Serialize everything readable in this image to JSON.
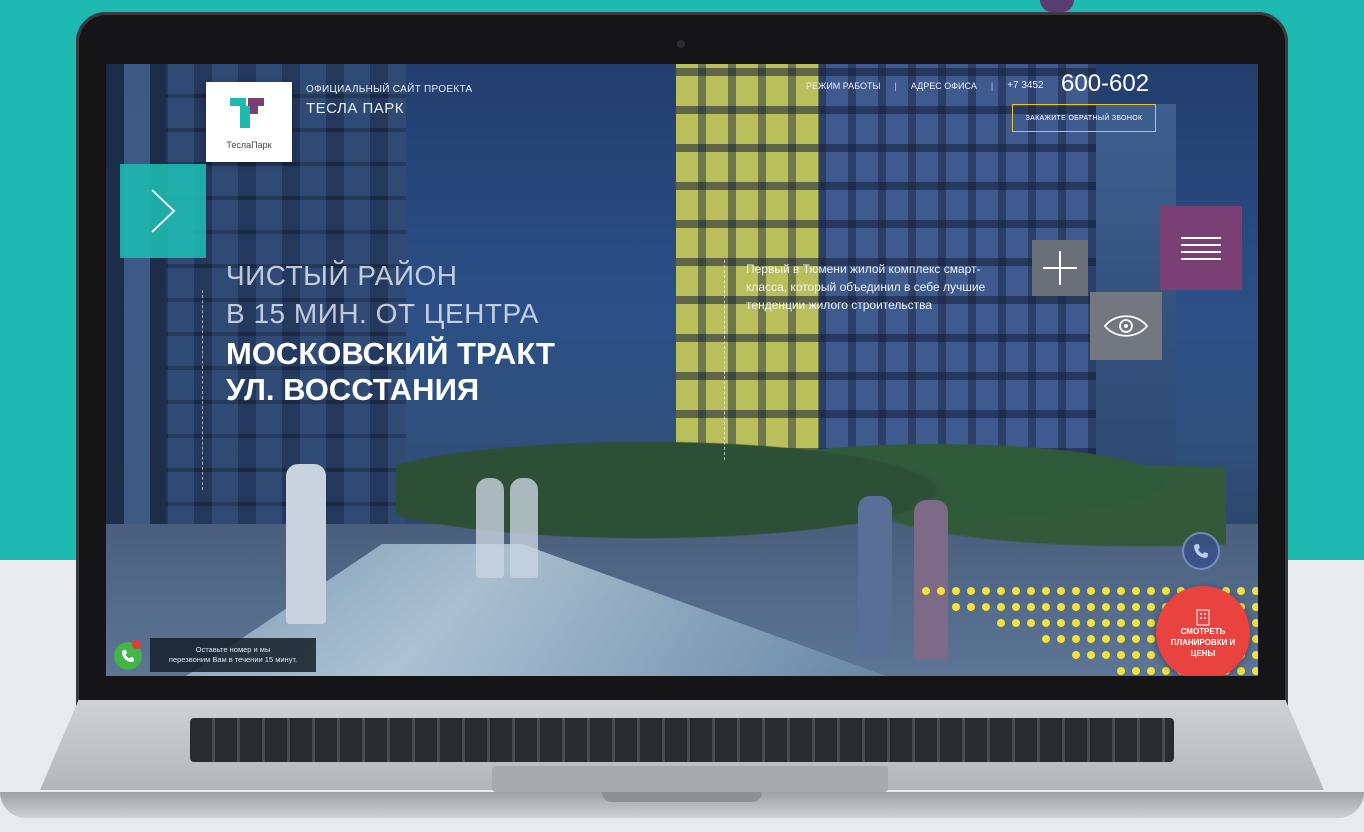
{
  "header": {
    "site_label": "ОФИЦИАЛЬНЫЙ САЙТ ПРОЕКТА",
    "project_name": "ТЕСЛА ПАРК",
    "logo_text": "ТеслаПарк",
    "nav": [
      {
        "label": "РЕЖИМ РАБОТЫ"
      },
      {
        "label": "АДРЕС ОФИСА"
      }
    ],
    "phone_prefix": "+7 3452",
    "phone_main": "600-602",
    "callback_button": "ЗАКАЖИТЕ ОБРАТНЫЙ ЗВОНОК"
  },
  "hero": {
    "line1": "ЧИСТЫЙ РАЙОН",
    "line2": "В 15 МИН. ОТ ЦЕНТРА",
    "line3": "МОСКОВСКИЙ ТРАКТ",
    "line4": "УЛ. ВОССТАНИЯ"
  },
  "description": "Первый в Тюмени жилой комплекс смарт-класса, который объединил в себе лучшие тенденции жилого строительства",
  "callback_widget": {
    "line1": "Оставьте номер и мы",
    "line2": "перезвоним Вам в течении 15 минут."
  },
  "cta": {
    "line1": "СМОТРЕТЬ",
    "line2": "ПЛАНИРОВКИ И",
    "line3": "ЦЕНЫ"
  },
  "icons": {
    "arrow": "chevron-right-icon",
    "menu": "hamburger-menu-icon",
    "plus": "plus-icon",
    "eye": "eye-icon",
    "phone": "phone-icon",
    "building": "building-icon"
  },
  "colors": {
    "teal": "#1eb9b0",
    "purple": "#7a3f75",
    "cta_red": "#e8433f",
    "gold_border": "#e7c23b",
    "dot_yellow": "#f2e33a"
  }
}
